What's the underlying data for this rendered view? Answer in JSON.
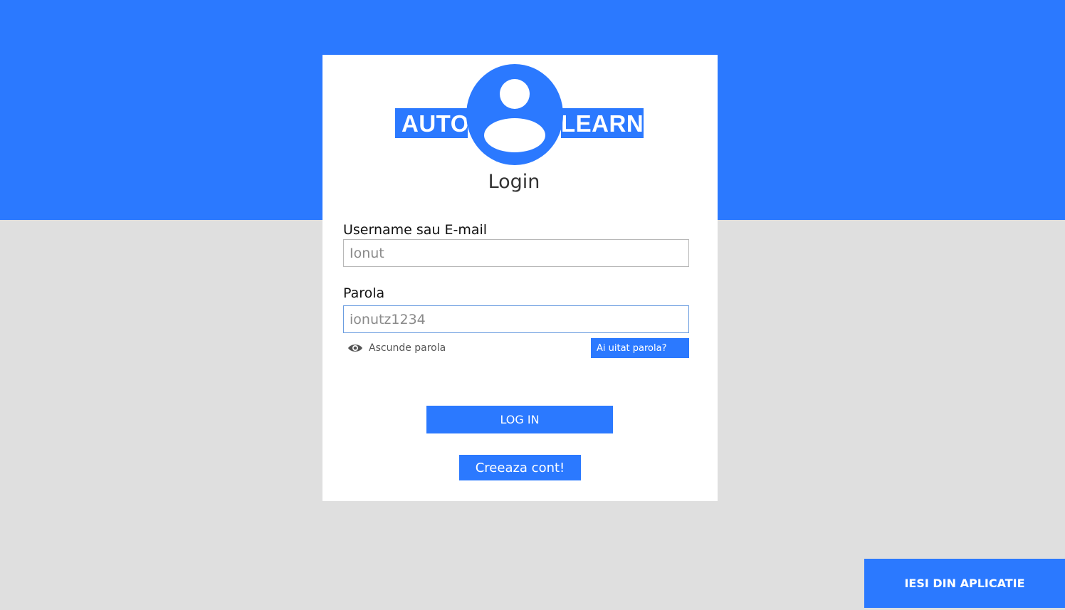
{
  "app": {
    "logo": {
      "left_text": "AUTO",
      "right_text": "LEARN"
    },
    "title": "Login"
  },
  "form": {
    "username": {
      "label": "Username sau E-mail",
      "value": "Ionut"
    },
    "password": {
      "label": "Parola",
      "value": "ionutz1234"
    },
    "show_password_label": "Ascunde parola",
    "forgot_password_label": "Ai uitat parola?",
    "login_label": "LOG IN",
    "create_account_label": "Creeaza cont!"
  },
  "footer": {
    "exit_label": "IESI DIN APLICATIE"
  },
  "colors": {
    "accent": "#2b79ff",
    "background": "#dfdfdf",
    "card": "#ffffff"
  },
  "icons": {
    "logo": "user-avatar-icon",
    "show_password": "eye-icon"
  }
}
